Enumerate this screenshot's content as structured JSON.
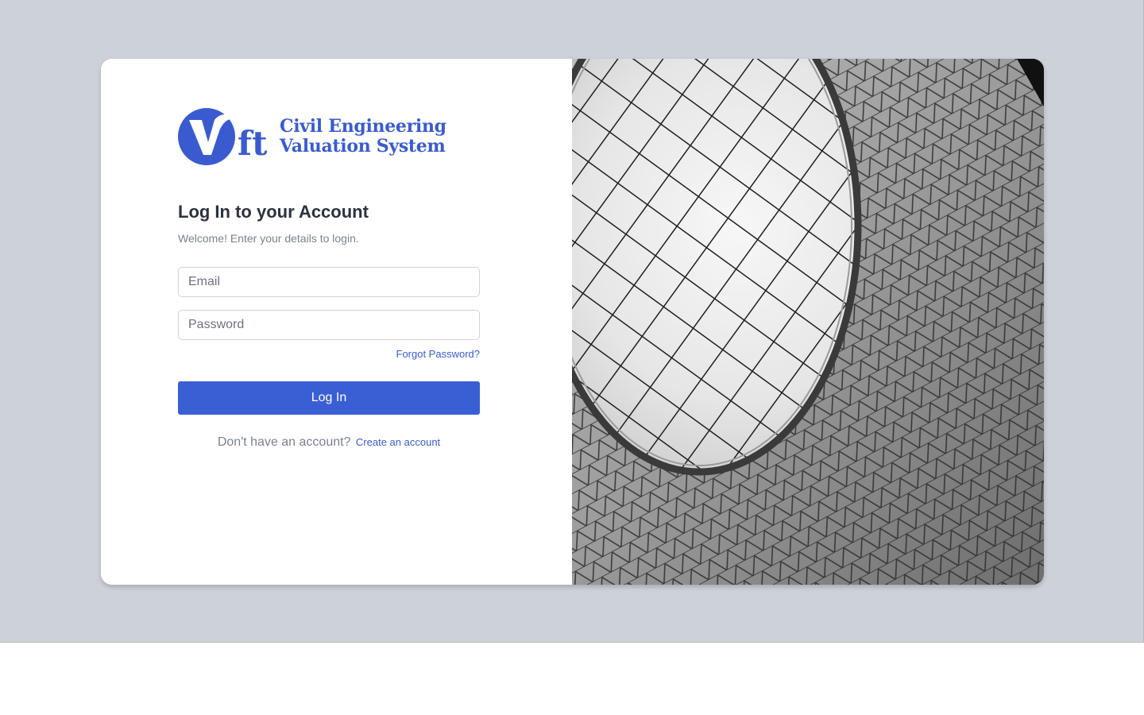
{
  "brand": {
    "logo_letters": "ft",
    "name_line1": "Civil Engineering",
    "name_line2": "Valuation System",
    "color": "#3a5bd0"
  },
  "login": {
    "heading": "Log In to your Account",
    "subheading": "Welcome! Enter your details to login.",
    "email_placeholder": "Email",
    "email_value": "",
    "password_placeholder": "Password",
    "password_value": "",
    "forgot_label": "Forgot Password?",
    "submit_label": "Log In",
    "signup_prompt": "Don't have an account?",
    "signup_link": "Create an account"
  },
  "image": {
    "description_icon": "architecture-photo"
  },
  "colors": {
    "page_background": "#cdd1d8",
    "button": "#3a5fd4",
    "link": "#3a5bd0",
    "heading": "#2b3240",
    "muted": "#7a8290"
  }
}
